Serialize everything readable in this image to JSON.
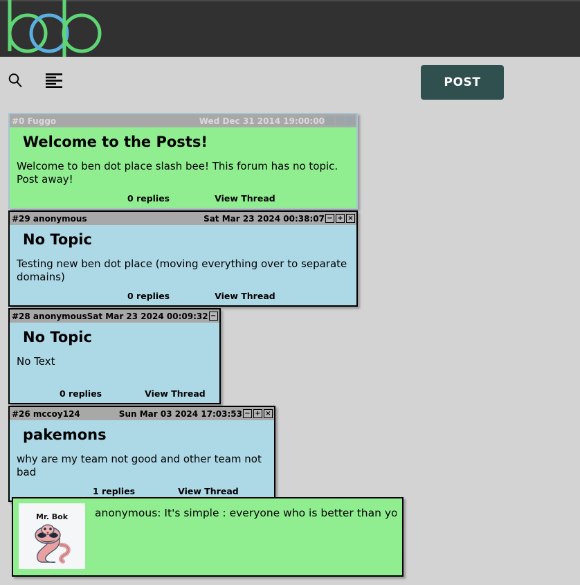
{
  "site": {
    "logo_text": "bop",
    "logo_colors": {
      "green": "#5fd675",
      "blue": "#5aaee0"
    },
    "banner_color": "#313131",
    "page_background": "#d3d3d3"
  },
  "toolbar": {
    "search_icon": "search-icon",
    "menu_icon": "menu-list-icon",
    "post_label": "POST",
    "post_color": "#2f504e"
  },
  "posts": [
    {
      "id": "#0",
      "author": "Fuggo",
      "header_left": "#0 Fuggo",
      "date": "Wed Dec 31 2014 19:00:00",
      "title": "Welcome to the Posts!",
      "text": "Welcome to ben dot place slash bee! This forum has no topic. Post away!",
      "replies": "0 replies",
      "view_thread": "View Thread",
      "body_color": "#90ee90",
      "minimize": "−",
      "maximize": "+",
      "close": "×"
    },
    {
      "id": "#29",
      "author": "anonymous",
      "header_left": "#29 anonymous",
      "date": "Sat Mar 23 2024 00:38:07",
      "title": "No Topic",
      "text": "Testing new ben dot place (moving everything over to separate domains)",
      "replies": "0 replies",
      "view_thread": "View Thread",
      "body_color": "#add8e6",
      "minimize": "−",
      "maximize": "+",
      "close": "×"
    },
    {
      "id": "#28",
      "author": "anonymous",
      "header_left": "#28 anonymous",
      "date": "Sat Mar 23 2024 00:09:32",
      "title": "No Topic",
      "text": "No Text",
      "replies": "0 replies",
      "view_thread": "View Thread",
      "body_color": "#add8e6",
      "minimize": "−",
      "maximize": "+",
      "close": "×"
    },
    {
      "id": "#26",
      "author": "mccoy124",
      "header_left": "#26 mccoy124",
      "date": "Sun Mar 03 2024 17:03:53",
      "title": "pakemons",
      "text": "why are my team not good and other team not bad",
      "replies": "1 replies",
      "view_thread": "View Thread",
      "body_color": "#add8e6",
      "minimize": "−",
      "maximize": "+",
      "close": "×"
    }
  ],
  "reply_card": {
    "thumb_label": "Mr. Bok",
    "thumb_icon": "arbok-sprite-icon",
    "text": "anonymous: It's simple : everyone who is better than you c…",
    "body_color": "#90ee90"
  }
}
